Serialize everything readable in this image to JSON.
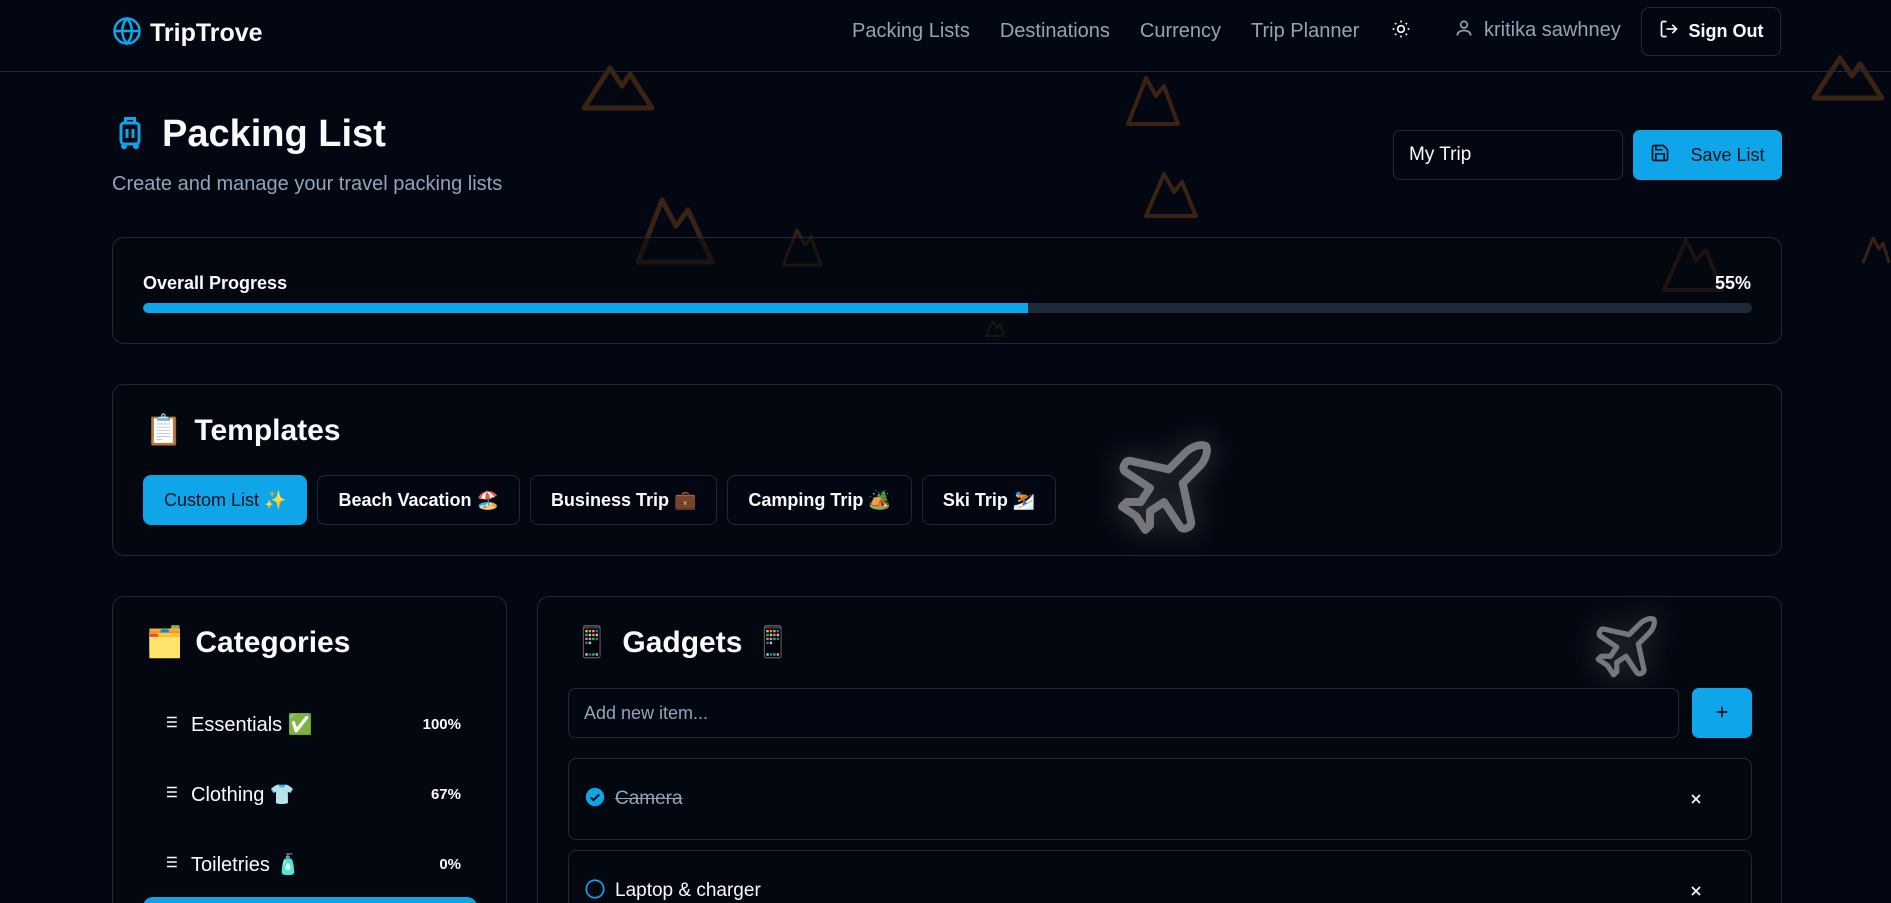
{
  "nav": {
    "brand": "TripTrove",
    "links": [
      "Packing Lists",
      "Destinations",
      "Currency",
      "Trip Planner"
    ],
    "user_name": "kritika sawhney",
    "sign_out": "Sign Out"
  },
  "header": {
    "title": "Packing List",
    "subtitle": "Create and manage your travel packing lists",
    "trip_name_value": "My Trip",
    "save_label": "Save List"
  },
  "progress": {
    "label": "Overall Progress",
    "value_text": "55%",
    "value": 55
  },
  "templates": {
    "heading": "Templates",
    "heading_emoji": "📋",
    "items": [
      {
        "label": "Custom List ✨",
        "active": true
      },
      {
        "label": "Beach Vacation 🏖️",
        "active": false
      },
      {
        "label": "Business Trip 💼",
        "active": false
      },
      {
        "label": "Camping Trip 🏕️",
        "active": false
      },
      {
        "label": "Ski Trip ⛷️",
        "active": false
      }
    ]
  },
  "categories": {
    "heading": "Categories",
    "heading_emoji": "🗂️",
    "items": [
      {
        "label": "Essentials ✅",
        "pct": "100%"
      },
      {
        "label": "Clothing 👕",
        "pct": "67%"
      },
      {
        "label": "Toiletries 🧴",
        "pct": "0%"
      }
    ]
  },
  "items_panel": {
    "heading": "Gadgets",
    "heading_emoji": "📱",
    "add_placeholder": "Add new item...",
    "items": [
      {
        "label": "Camera",
        "checked": true
      },
      {
        "label": "Laptop & charger",
        "checked": false
      }
    ]
  },
  "colors": {
    "accent": "#0ea5e9",
    "background": "#030711",
    "border": "#1e293b",
    "muted_text": "#94a3b8",
    "decor_mountain": "#3b2314"
  },
  "icons": {
    "brand": "globe-icon",
    "theme": "sun-icon",
    "user": "user-icon",
    "sign_out": "log-out-icon",
    "title": "luggage-icon",
    "save": "save-icon",
    "category": "list-icon",
    "add": "plus-icon",
    "remove": "x-icon",
    "checked": "check-circle-icon",
    "unchecked": "circle-icon"
  }
}
